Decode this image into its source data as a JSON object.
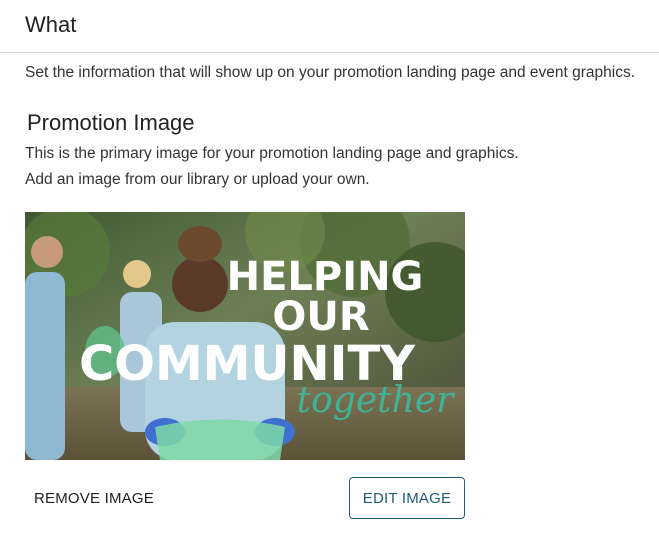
{
  "header": {
    "title": "What"
  },
  "intro": "Set the information that will show up on your promotion landing page and event graphics.",
  "promotion_image": {
    "title": "Promotion Image",
    "description_1": "This is the primary image for your promotion landing page and graphics.",
    "description_2": "Add an image from our library or upload your own.",
    "image_text": {
      "line1": "HELPING",
      "line2": "OUR",
      "line3": "COMMUNITY",
      "line4": "together"
    }
  },
  "actions": {
    "remove_label": "REMOVE IMAGE",
    "edit_label": "EDIT IMAGE"
  },
  "colors": {
    "accent": "#1f5a78",
    "script_teal": "#3fb39a"
  }
}
